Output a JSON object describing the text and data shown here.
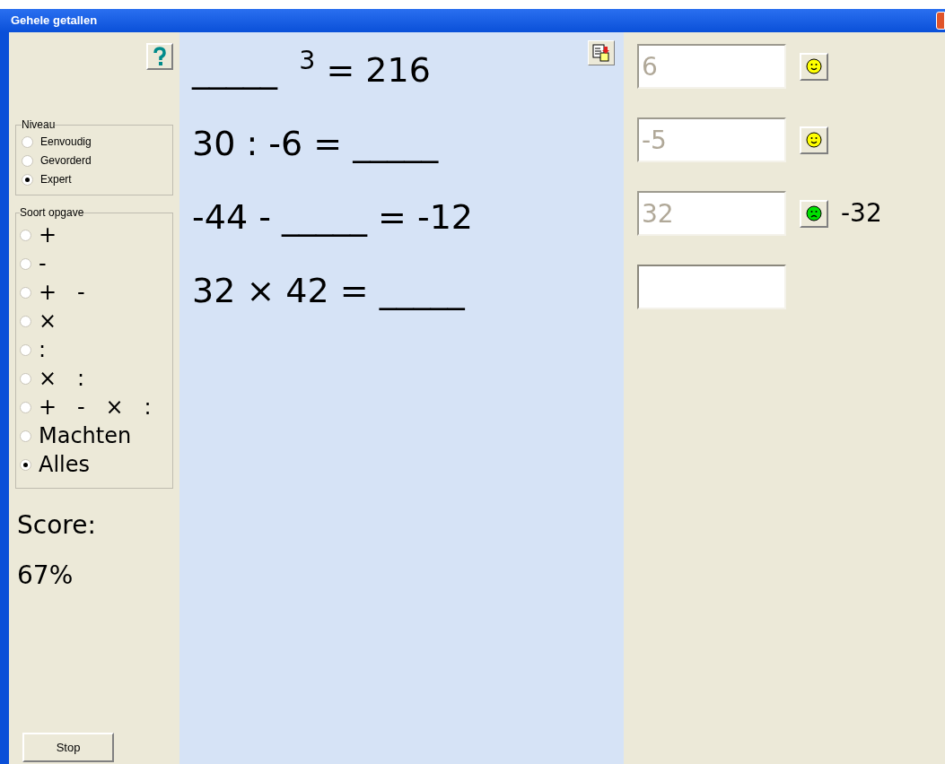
{
  "window": {
    "title": "Gehele getallen"
  },
  "niveau": {
    "title": "Niveau",
    "options": [
      {
        "label": "Eenvoudig",
        "selected": false
      },
      {
        "label": "Gevorderd",
        "selected": false
      },
      {
        "label": "Expert",
        "selected": true
      }
    ]
  },
  "soort_opgave": {
    "title": "Soort opgave",
    "options": [
      {
        "label": "+",
        "selected": false
      },
      {
        "label": "-",
        "selected": false
      },
      {
        "label": "+   -",
        "selected": false
      },
      {
        "label": "×",
        "selected": false
      },
      {
        "label": ":",
        "selected": false
      },
      {
        "label": "×   :",
        "selected": false
      },
      {
        "label": "+   -   ×   :",
        "selected": false
      },
      {
        "label": "Machten",
        "selected": false
      },
      {
        "label": "Alles",
        "selected": true
      }
    ]
  },
  "score": {
    "label": "Score:",
    "value": "67%"
  },
  "stop_button": "Stop",
  "questions": [
    {
      "text": "_____  $^{3}$ = 216"
    },
    {
      "text": "30 : -6 = _____"
    },
    {
      "text": "-44 - _____ = -12"
    },
    {
      "text": "32 × 42 = _____"
    }
  ],
  "answers": [
    {
      "value": "6",
      "disabled": true,
      "checked": true,
      "correct": true
    },
    {
      "value": "-5",
      "disabled": true,
      "checked": true,
      "correct": true
    },
    {
      "value": "32",
      "disabled": true,
      "checked": true,
      "correct": false,
      "correction": "-32"
    },
    {
      "disabled": false,
      "checked": false
    }
  ]
}
